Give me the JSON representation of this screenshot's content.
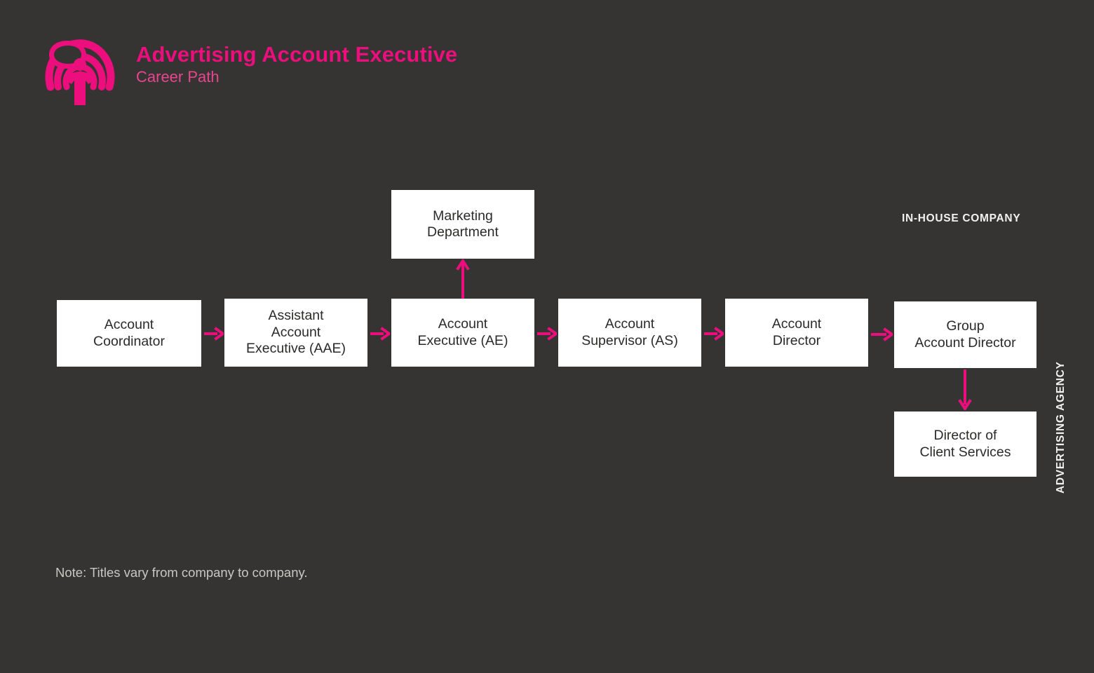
{
  "page": {
    "background_color": "#353432",
    "accent_color": "#EC0E7C",
    "node_fill_color": "#FFFFFF",
    "node_text_color": "#2B2A28",
    "label_text_color": "#F2F1EF"
  },
  "header": {
    "logo_name": "broadcast-person-logo",
    "title": "Advertising Account Executive",
    "subtitle": "Career Path"
  },
  "labels": {
    "in_house": "IN-HOUSE COMPANY",
    "agency": "ADVERTISING AGENCY"
  },
  "chart_data": {
    "type": "diagram",
    "title": "Advertising Account Executive Career Path",
    "nodes": [
      {
        "id": "account-coordinator",
        "label": "Account\nCoordinator",
        "line1": "Account",
        "line2": "Coordinator",
        "line3": ""
      },
      {
        "id": "assistant-account-exec",
        "label": "Assistant Account Executive (AAE)",
        "line1": "Assistant",
        "line2": "Account",
        "line3": "Executive (AAE)"
      },
      {
        "id": "marketing-department",
        "label": "Marketing Department",
        "line1": "Marketing",
        "line2": "Department",
        "line3": ""
      },
      {
        "id": "account-executive",
        "label": "Account Executive (AE)",
        "line1": "Account",
        "line2": "Executive (AE)",
        "line3": ""
      },
      {
        "id": "account-supervisor",
        "label": "Account Supervisor (AS)",
        "line1": "Account",
        "line2": "Supervisor (AS)",
        "line3": ""
      },
      {
        "id": "account-director",
        "label": "Account Director",
        "line1": "Account",
        "line2": "Director",
        "line3": ""
      },
      {
        "id": "group-account-director",
        "label": "Group Account Director",
        "line1": "Group",
        "line2": "Account Director",
        "line3": ""
      },
      {
        "id": "director-client-svcs",
        "label": "Director of Client Services",
        "line1": "Director of",
        "line2": "Client Services",
        "line3": ""
      }
    ],
    "edges": [
      {
        "from": "account-coordinator",
        "to": "assistant-account-exec",
        "direction": "right"
      },
      {
        "from": "assistant-account-exec",
        "to": "account-executive",
        "direction": "right"
      },
      {
        "from": "account-executive",
        "to": "marketing-department",
        "direction": "up"
      },
      {
        "from": "account-executive",
        "to": "account-supervisor",
        "direction": "right"
      },
      {
        "from": "account-supervisor",
        "to": "account-director",
        "direction": "right"
      },
      {
        "from": "account-director",
        "to": "group-account-director",
        "direction": "right"
      },
      {
        "from": "group-account-director",
        "to": "director-client-svcs",
        "direction": "down"
      }
    ],
    "groups": [
      {
        "name": "IN-HOUSE COMPANY",
        "nodes": [
          "marketing-department"
        ]
      },
      {
        "name": "ADVERTISING AGENCY",
        "nodes": [
          "account-coordinator",
          "assistant-account-exec",
          "account-executive",
          "account-supervisor",
          "account-director",
          "group-account-director",
          "director-client-svcs"
        ]
      }
    ]
  },
  "footer": {
    "note": "Note: Titles vary from company to company."
  }
}
